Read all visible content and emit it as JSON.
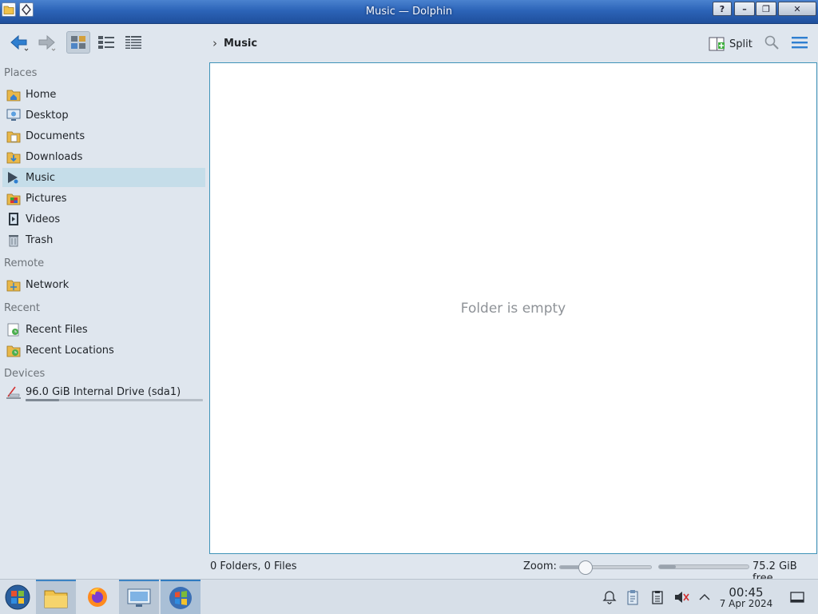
{
  "window": {
    "title": "Music — Dolphin"
  },
  "titlebar": {
    "help_glyph": "?",
    "minimize_glyph": "–",
    "maximize_glyph": "❐",
    "close_glyph": "✕"
  },
  "toolbar": {
    "back_icon": "back-arrow-icon",
    "forward_icon": "forward-arrow-icon",
    "view_modes": [
      "icons-view",
      "compact-view",
      "details-view"
    ],
    "active_view_mode": "icons-view",
    "breadcrumb": {
      "separator": "›",
      "current": "Music"
    },
    "split_label": "Split",
    "search_icon": "search-icon",
    "menu_icon": "hamburger-menu-icon"
  },
  "places": {
    "sections": {
      "places": "Places",
      "remote": "Remote",
      "recent": "Recent",
      "devices": "Devices"
    },
    "items": [
      {
        "label": "Home",
        "icon": "home-folder-icon"
      },
      {
        "label": "Desktop",
        "icon": "desktop-folder-icon"
      },
      {
        "label": "Documents",
        "icon": "documents-folder-icon"
      },
      {
        "label": "Downloads",
        "icon": "downloads-folder-icon"
      },
      {
        "label": "Music",
        "icon": "music-folder-icon",
        "selected": true
      },
      {
        "label": "Pictures",
        "icon": "pictures-folder-icon"
      },
      {
        "label": "Videos",
        "icon": "videos-folder-icon"
      },
      {
        "label": "Trash",
        "icon": "trash-icon"
      }
    ],
    "remote_items": [
      {
        "label": "Network",
        "icon": "network-folder-icon"
      }
    ],
    "recent_items": [
      {
        "label": "Recent Files",
        "icon": "recent-files-icon"
      },
      {
        "label": "Recent Locations",
        "icon": "recent-locations-icon"
      }
    ],
    "devices": [
      {
        "label": "96.0 GiB Internal Drive (sda1)",
        "icon": "drive-icon",
        "usage_fraction": 0.19
      }
    ]
  },
  "view": {
    "empty_message": "Folder is empty"
  },
  "statusbar": {
    "counts": "0 Folders, 0 Files",
    "zoom_label": "Zoom:",
    "zoom_level_fraction": 0.28,
    "free_space": "75.2 GiB free",
    "space_used_fraction": 0.19
  },
  "taskbar": {
    "apps": [
      "start-menu-icon",
      "file-manager-icon",
      "firefox-icon",
      "system-settings-icon",
      "windows-app-icon"
    ],
    "tray": [
      "alarm-bell-icon",
      "clipboard-icon",
      "notes-icon",
      "muted-speaker-icon",
      "chevron-up-icon"
    ],
    "clock_time": "00:45",
    "clock_date": "7 Apr 2024",
    "show_desktop_icon": "show-desktop-icon"
  },
  "colors": {
    "accent": "#3f93b8",
    "selection": "#c5dde9",
    "window_bg": "#dfe6ee",
    "titlebar": "#2c64b8"
  }
}
